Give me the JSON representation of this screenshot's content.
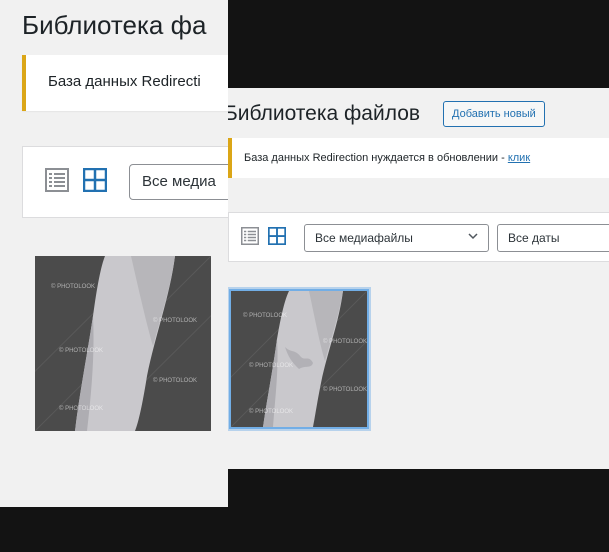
{
  "back_window": {
    "page_title": "Библиотека фа",
    "notice_text": "База данных Redirecti",
    "filter_select": "Все медиа"
  },
  "front_window": {
    "page_title": "Библиотека файлов",
    "add_new_label": "Добавить новый",
    "notice_text": "База данных Redirection нуждается в обновлении - ",
    "notice_link": "клик",
    "media_filter": "Все медиафайлы",
    "date_filter": "Все даты"
  },
  "thumbnail_watermark": "© PHOTOLOOK",
  "colors": {
    "accent": "#2271b1",
    "notice_border": "#dba617",
    "selection_outline": "#72aee6"
  }
}
